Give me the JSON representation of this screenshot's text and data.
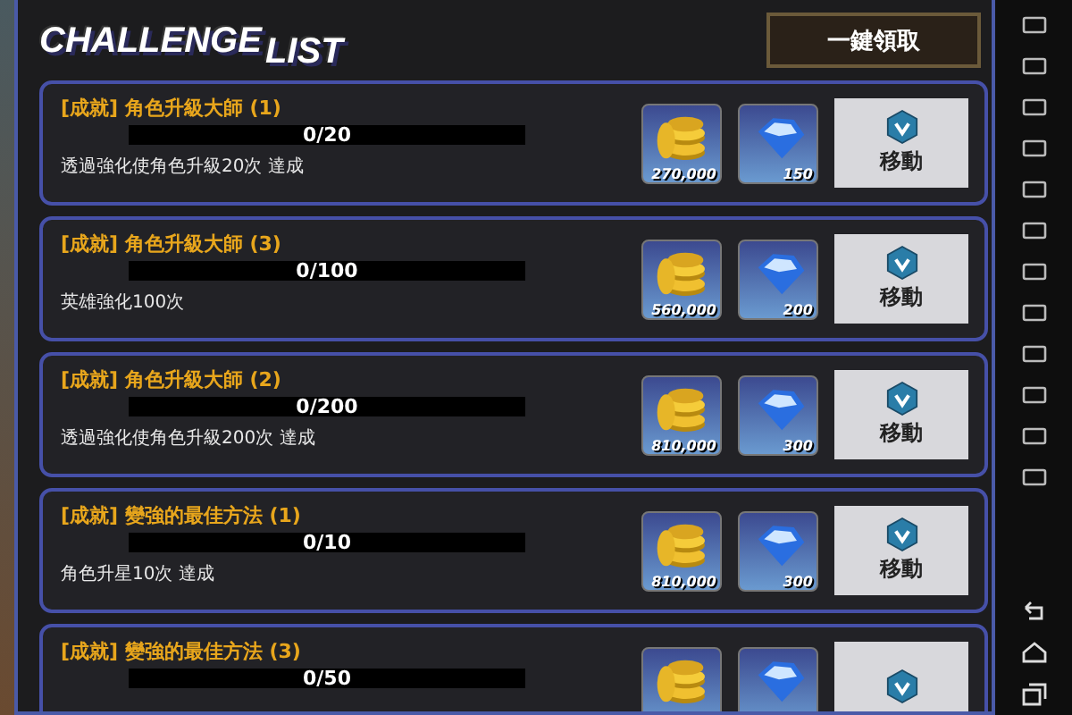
{
  "header": {
    "title_part_1": "CHALLENGE",
    "title_part_2": "LIST",
    "claim_all_button": "一鍵領取"
  },
  "challenges": [
    {
      "title": "[成就] 角色升級大師 (1)",
      "progress": "0/20",
      "level": 0,
      "description": "透過強化使角色升級20次 達成",
      "coins": "270,000",
      "gems": "150",
      "button": "移動"
    },
    {
      "title": "[成就] 角色升級大師 (3)",
      "progress": "0/100",
      "level": 0,
      "description": "英雄強化100次",
      "coins": "560,000",
      "gems": "200",
      "button": "移動"
    },
    {
      "title": "[成就] 角色升級大師 (2)",
      "progress": "0/200",
      "level": 0,
      "description": "透過強化使角色升級200次 達成",
      "coins": "810,000",
      "gems": "300",
      "button": "移動"
    },
    {
      "title": "[成就] 變強的最佳方法 (1)",
      "progress": "0/10",
      "level": 0,
      "description": "角色升星10次 達成",
      "coins": "810,000",
      "gems": "300",
      "button": "移動"
    },
    {
      "title": "[成就] 變強的最佳方法 (3)",
      "progress": "0/50",
      "level": 0
    }
  ]
}
